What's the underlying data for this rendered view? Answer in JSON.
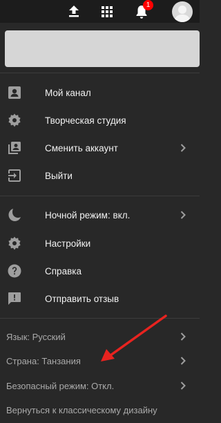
{
  "topbar": {
    "notification_count": "1"
  },
  "account_menu": [
    {
      "label": "Мой канал",
      "icon": "account-box-icon"
    },
    {
      "label": "Творческая студия",
      "icon": "gear-icon"
    },
    {
      "label": "Сменить аккаунт",
      "icon": "switch-account-icon",
      "chevron": true
    },
    {
      "label": "Выйти",
      "icon": "sign-out-icon"
    }
  ],
  "settings_menu": [
    {
      "label": "Ночной режим: вкл.",
      "icon": "moon-icon",
      "chevron": true
    },
    {
      "label": "Настройки",
      "icon": "gear-icon"
    },
    {
      "label": "Справка",
      "icon": "help-icon"
    },
    {
      "label": "Отправить отзыв",
      "icon": "feedback-icon"
    }
  ],
  "footer_menu": [
    {
      "label": "Язык: Русский",
      "chevron": true
    },
    {
      "label": "Страна: Танзания",
      "chevron": true
    },
    {
      "label": "Безопасный режим: Откл.",
      "chevron": true
    },
    {
      "label": "Вернуться к классическому дизайну"
    }
  ],
  "colors": {
    "background": "#282828",
    "topbar": "#1c1c1c",
    "badge": "#ff0000",
    "annotation_arrow": "#e8231f"
  }
}
